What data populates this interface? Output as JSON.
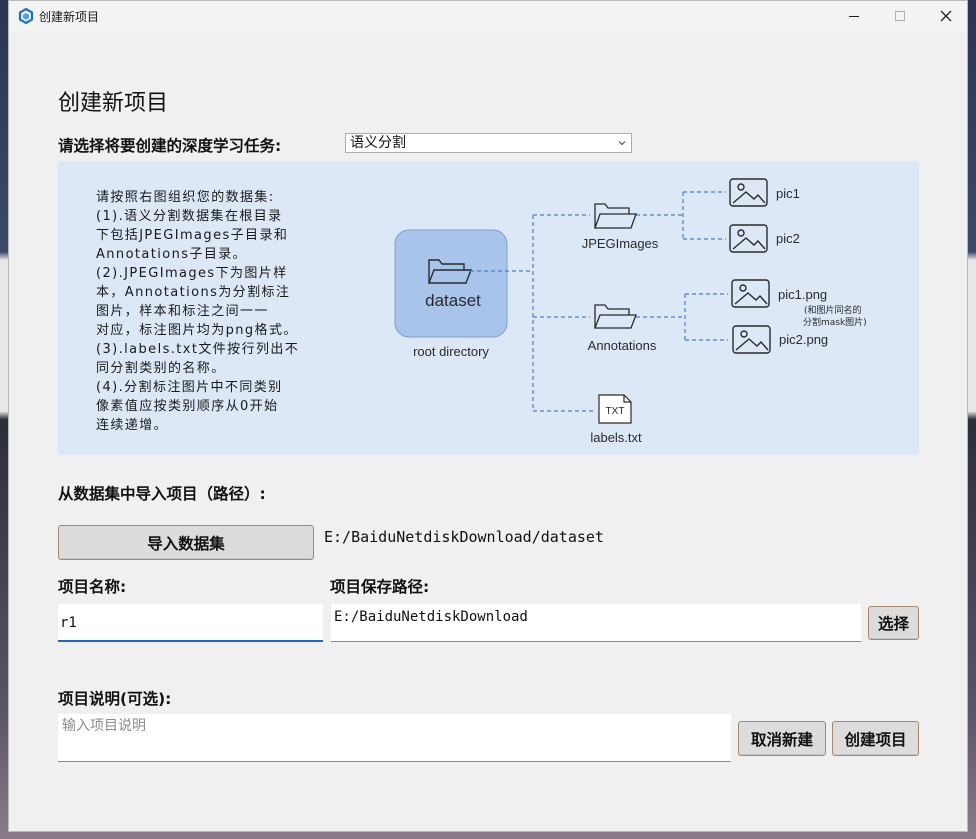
{
  "window": {
    "title": "创建新项目"
  },
  "heading": "创建新项目",
  "task": {
    "label": "请选择将要创建的深度学习任务:",
    "selected": "语义分割"
  },
  "instructions": [
    "请按照右图组织您的数据集:",
    "(1).语义分割数据集在根目录",
    "下包括JPEGImages子目录和",
    "Annotations子目录。",
    "(2).JPEGImages下为图片样",
    "本，Annotations为分割标注",
    "图片，样本和标注之间一一",
    "对应，标注图片均为png格式。",
    "(3).labels.txt文件按行列出不",
    "同分割类别的名称。",
    "(4).分割标注图片中不同类别",
    "像素值应按类别顺序从0开始",
    "连续递增。"
  ],
  "diagram": {
    "root_name": "dataset",
    "root_caption": "root directory",
    "jpeg_folder": "JPEGImages",
    "anno_folder": "Annotations",
    "labels_file": "labels.txt",
    "txt_icon_text": "TXT",
    "pic1": "pic1",
    "pic2": "pic2",
    "pic1_png": "pic1.png",
    "pic2_png": "pic2.png",
    "note_line1": "(和图片同名的",
    "note_line2": "分割mask图片)"
  },
  "import": {
    "label": "从数据集中导入项目（路径）:",
    "button": "导入数据集",
    "path": "E:/BaiduNetdiskDownload/dataset"
  },
  "project_name": {
    "label": "项目名称:",
    "value": "r1"
  },
  "save_path": {
    "label": "项目保存路径:",
    "value": "E:/BaiduNetdiskDownload",
    "button": "选择"
  },
  "description": {
    "label": "项目说明(可选):",
    "placeholder": "输入项目说明"
  },
  "actions": {
    "cancel": "取消新建",
    "create": "创建项目"
  },
  "colors": {
    "panel_bg": "#dce8f5",
    "root_box": "#a9c4ea",
    "dashed_line": "#4a7fd0",
    "focus": "#1d66c4"
  }
}
